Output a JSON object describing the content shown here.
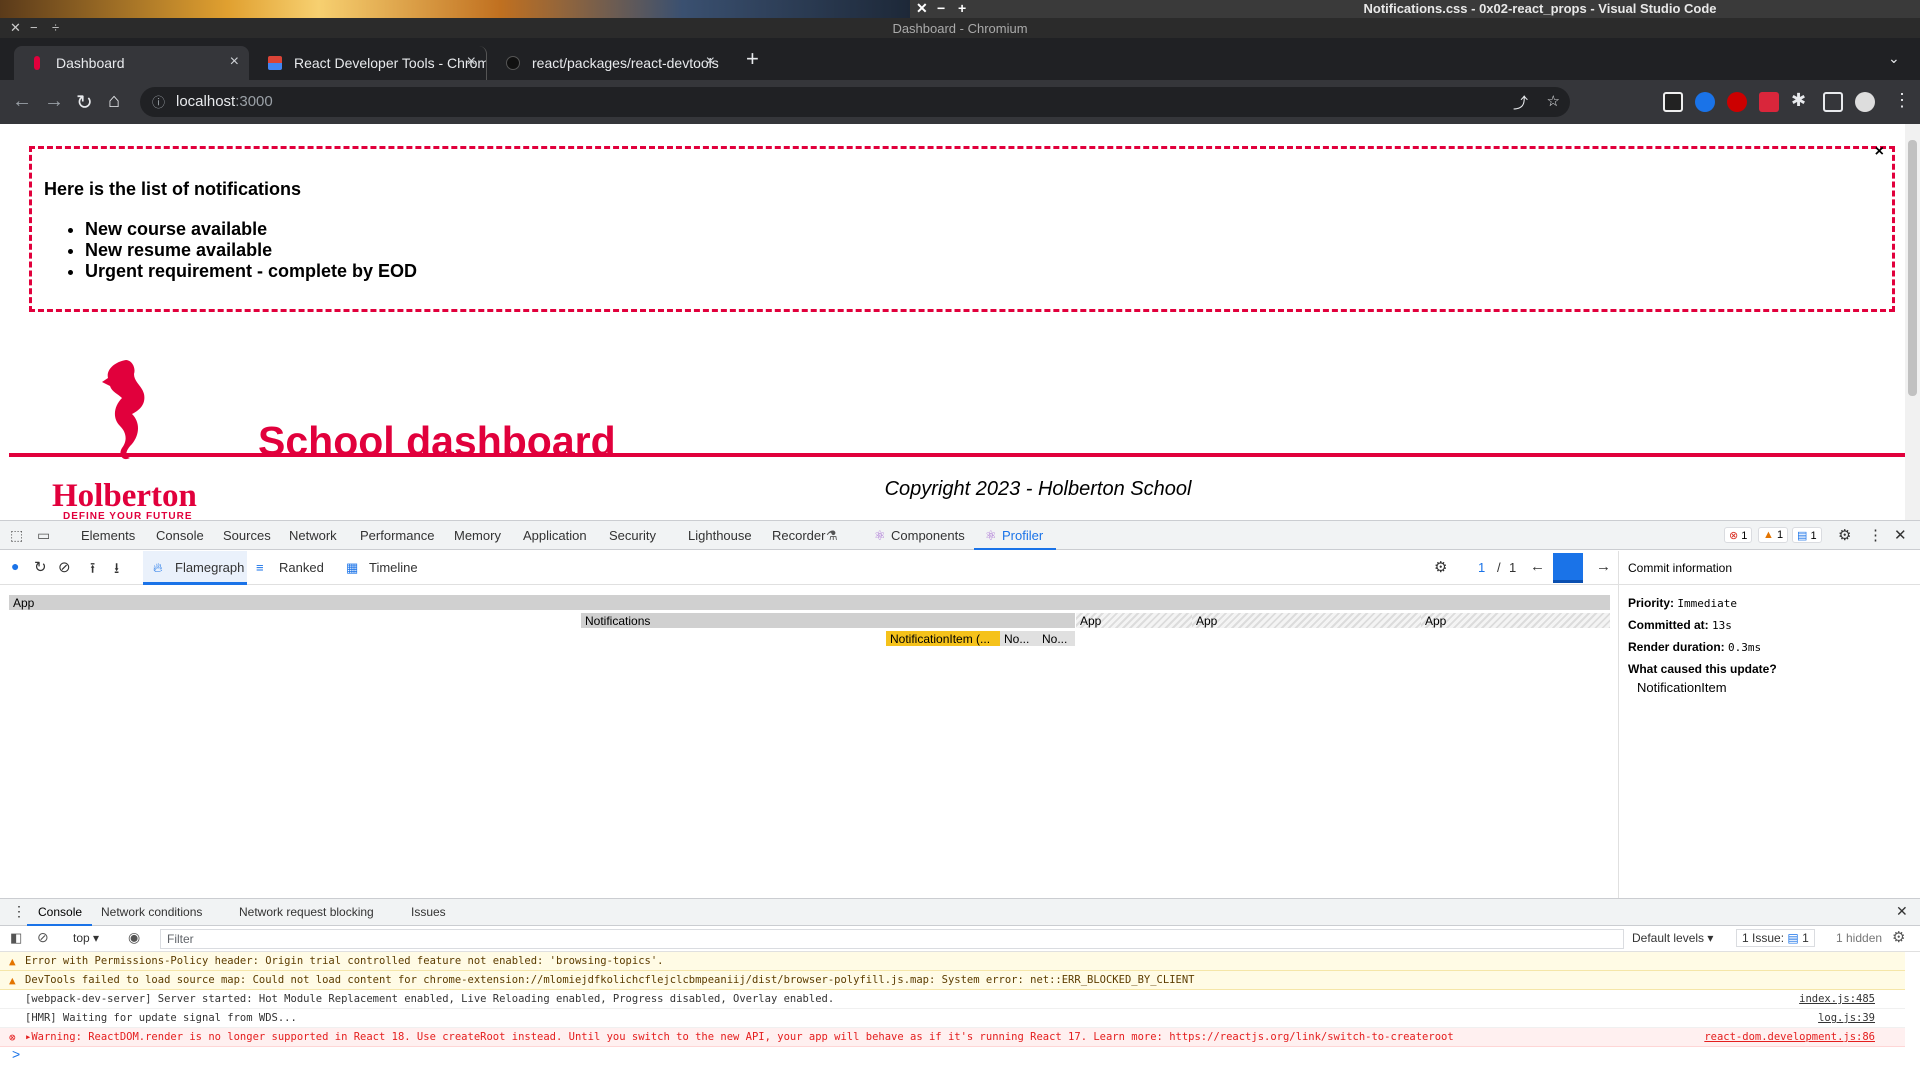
{
  "os": {
    "title": "Notifications.css - 0x02-react_props - Visual Studio Code",
    "controls": [
      "✕",
      "−",
      "+"
    ]
  },
  "window": {
    "title": "Dashboard - Chromium"
  },
  "tabs": [
    {
      "label": "Dashboard",
      "close": "×"
    },
    {
      "label": "React Developer Tools - Chrom",
      "close": "×"
    },
    {
      "label": "react/packages/react-devtools",
      "close": "×"
    }
  ],
  "new_tab": "+",
  "address": {
    "host": "localhost",
    "port": ":3000"
  },
  "page": {
    "notifications_title": "Here is the list of notifications",
    "notifications": [
      "New course available",
      "New resume available",
      "Urgent requirement - complete by EOD"
    ],
    "close": "×",
    "header_title": "School dashboard",
    "logo_word": "Holberton",
    "logo_tag": "DEFINE YOUR FUTURE",
    "copyright": "Copyright 2023 - Holberton School"
  },
  "devtools": {
    "tabs": [
      "Elements",
      "Console",
      "Sources",
      "Network",
      "Performance",
      "Memory",
      "Application",
      "Security",
      "Lighthouse",
      "Recorder",
      "Components",
      "Profiler"
    ],
    "errors": "1",
    "warnings": "1",
    "messages": "1",
    "profiler": {
      "views": [
        "Flamegraph",
        "Ranked",
        "Timeline"
      ],
      "commit_index": "1",
      "commit_sep": "/",
      "commit_total": "1",
      "flame": {
        "root": "App",
        "notifications": "Notifications",
        "apps": [
          "App",
          "App",
          "App"
        ],
        "item": "NotificationItem (...",
        "small": [
          "No...",
          "No..."
        ]
      }
    },
    "commit": {
      "header": "Commit information",
      "priority_label": "Priority:",
      "priority": "Immediate",
      "committed_label": "Committed at:",
      "committed": "13s",
      "render_label": "Render duration:",
      "render": "0.3ms",
      "cause_label": "What caused this update?",
      "cause": "NotificationItem"
    }
  },
  "drawer": {
    "tabs": [
      "Console",
      "Network conditions",
      "Network request blocking",
      "Issues"
    ],
    "context": "top",
    "filter_placeholder": "Filter",
    "levels": "Default levels",
    "issues": "1 Issue:",
    "issues_count": "1",
    "hidden": "1 hidden",
    "lines": [
      {
        "type": "warn",
        "text": "Error with Permissions-Policy header: Origin trial controlled feature not enabled: 'browsing-topics'.",
        "src": ""
      },
      {
        "type": "warn",
        "text": "DevTools failed to load source map: Could not load content for chrome-extension://mlomiejdfkolichcflejclcbmpeaniij/dist/browser-polyfill.js.map: System error: net::ERR_BLOCKED_BY_CLIENT",
        "src": ""
      },
      {
        "type": "info",
        "text": "[webpack-dev-server] Server started: Hot Module Replacement enabled, Live Reloading enabled, Progress disabled, Overlay enabled.",
        "src": "index.js:485"
      },
      {
        "type": "info",
        "text": "[HMR] Waiting for update signal from WDS...",
        "src": "log.js:39"
      },
      {
        "type": "err",
        "text": "▸Warning: ReactDOM.render is no longer supported in React 18. Use createRoot instead. Until you switch to the new API, your app will behave as if it's running React 17. Learn more: https://reactjs.org/link/switch-to-createroot",
        "src": "react-dom.development.js:86"
      }
    ],
    "prompt": ">"
  },
  "colors": {
    "brand": "#e1003c",
    "devtools_accent": "#1a73e8"
  }
}
